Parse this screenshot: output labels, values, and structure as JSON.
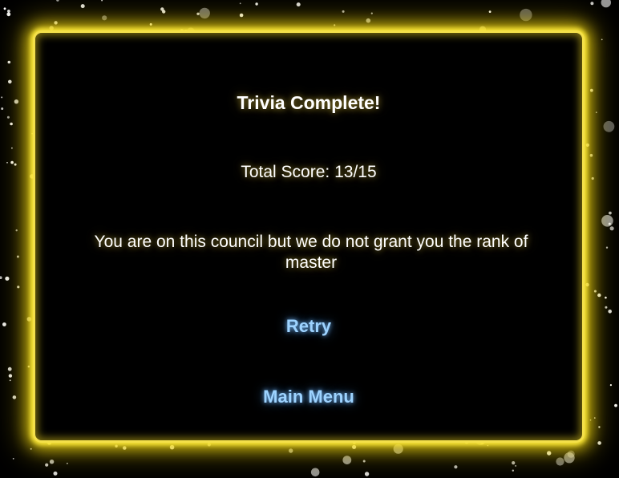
{
  "result": {
    "title": "Trivia Complete!",
    "score_text": "Total Score: 13/15",
    "message": "You are on this council but we do not grant you the rank of master"
  },
  "actions": {
    "retry_label": "Retry",
    "main_menu_label": "Main Menu"
  },
  "colors": {
    "background": "#000000",
    "border_glow": "#f4e04a",
    "text": "#ffffff",
    "button_text": "#9dd3ff"
  }
}
